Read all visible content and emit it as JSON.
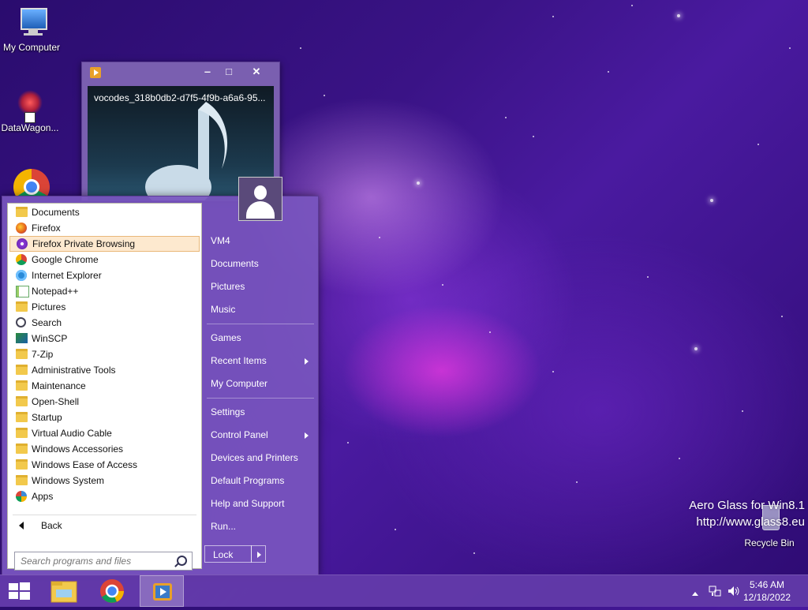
{
  "desktop": {
    "icons": [
      {
        "label": "My Computer",
        "icon": "computer-icon"
      },
      {
        "label": "DataWagon...",
        "icon": "datawagon-icon"
      },
      {
        "label": "",
        "icon": "chrome-icon"
      },
      {
        "label": "Recycle Bin",
        "icon": "recycle-bin-icon"
      }
    ],
    "watermark": {
      "line1": "Aero Glass for Win8.1",
      "line2": "http://www.glass8.eu"
    }
  },
  "media_window": {
    "title": "vocodes_318b0db2-d7f5-4f9b-a6a6-95...",
    "controls": {
      "minimize": "‒",
      "maximize": "□",
      "close": "✕"
    }
  },
  "start_menu": {
    "programs": [
      {
        "label": "Documents",
        "icon": "folder-icon"
      },
      {
        "label": "Firefox",
        "icon": "firefox-icon"
      },
      {
        "label": "Firefox Private Browsing",
        "icon": "firefox-private-icon",
        "highlighted": true
      },
      {
        "label": "Google Chrome",
        "icon": "chrome-icon"
      },
      {
        "label": "Internet Explorer",
        "icon": "ie-icon"
      },
      {
        "label": "Notepad++",
        "icon": "notepadpp-icon"
      },
      {
        "label": "Pictures",
        "icon": "folder-icon"
      },
      {
        "label": "Search",
        "icon": "search-icon"
      },
      {
        "label": "WinSCP",
        "icon": "winscp-icon"
      },
      {
        "label": "7-Zip",
        "icon": "folder-icon"
      },
      {
        "label": "Administrative Tools",
        "icon": "folder-icon"
      },
      {
        "label": "Maintenance",
        "icon": "folder-icon"
      },
      {
        "label": "Open-Shell",
        "icon": "folder-icon"
      },
      {
        "label": "Startup",
        "icon": "folder-icon"
      },
      {
        "label": "Virtual Audio Cable",
        "icon": "folder-icon"
      },
      {
        "label": "Windows Accessories",
        "icon": "folder-icon"
      },
      {
        "label": "Windows Ease of Access",
        "icon": "folder-icon"
      },
      {
        "label": "Windows System",
        "icon": "folder-icon"
      },
      {
        "label": "Apps",
        "icon": "apps-icon"
      }
    ],
    "back_label": "Back",
    "search_placeholder": "Search programs and files",
    "right_items": [
      {
        "label": "VM4"
      },
      {
        "label": "Documents"
      },
      {
        "label": "Pictures"
      },
      {
        "label": "Music"
      },
      {
        "label": "Games"
      },
      {
        "label": "Recent Items",
        "submenu": true
      },
      {
        "label": "My Computer"
      },
      {
        "label": "Settings"
      },
      {
        "label": "Control Panel",
        "submenu": true
      },
      {
        "label": "Devices and Printers"
      },
      {
        "label": "Default Programs"
      },
      {
        "label": "Help and Support"
      },
      {
        "label": "Run..."
      }
    ],
    "lock_label": "Lock"
  },
  "taskbar": {
    "time": "5:46 AM",
    "date": "12/18/2022",
    "pinned": [
      "start-button",
      "file-explorer-icon",
      "chrome-icon",
      "media-player-icon"
    ]
  },
  "colors": {
    "accent": "#7855be",
    "highlight": "#fde9cf"
  }
}
